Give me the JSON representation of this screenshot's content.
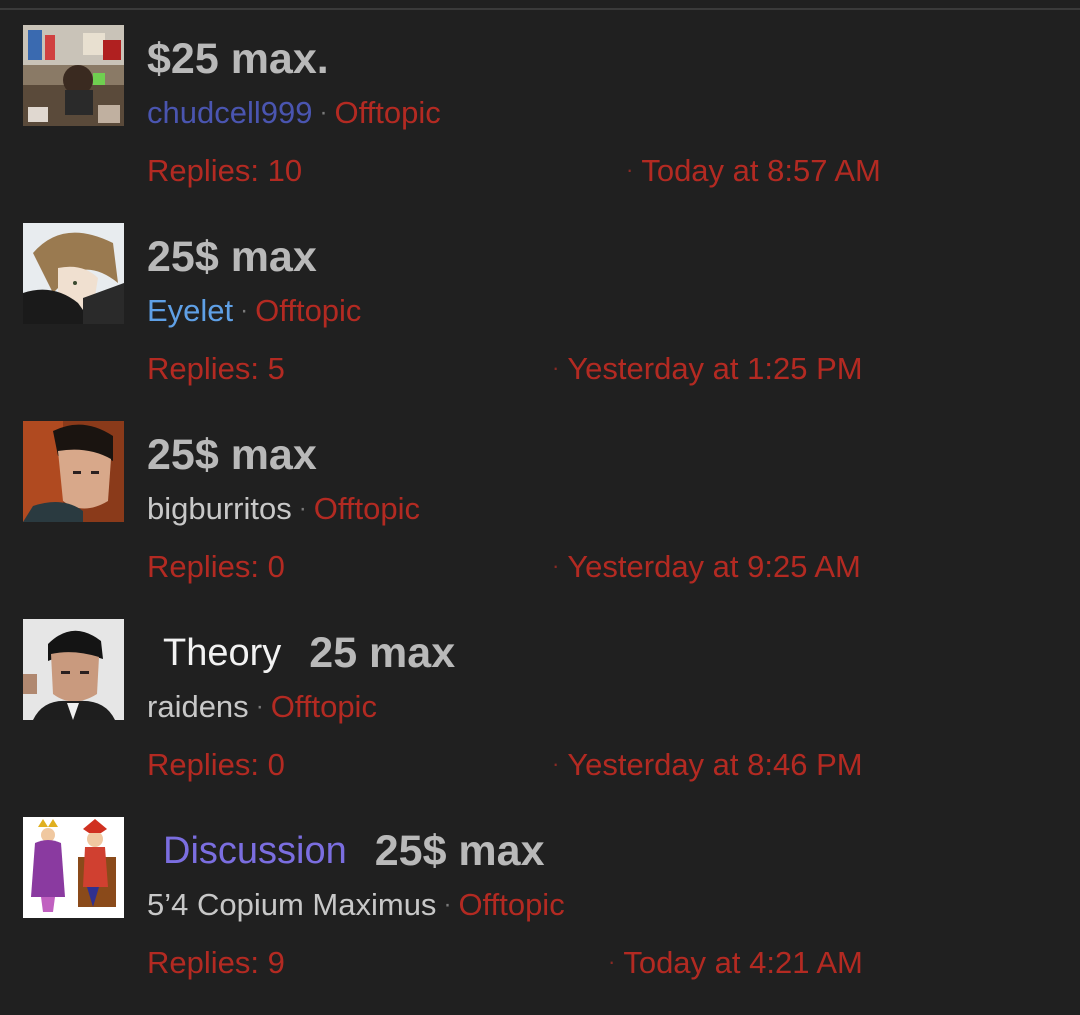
{
  "threads": [
    {
      "title": "$25 max.",
      "prefix": "",
      "author": "chudcell999",
      "author_color": "#4a55b0",
      "forum": "Offtopic",
      "replies": "Replies: 10",
      "date": "Today at 8:57 AM",
      "avatar_icon": "cluttered-room-avatar"
    },
    {
      "title": "25$ max",
      "prefix": "",
      "author": "Eyelet",
      "author_color": "#5fa0e6",
      "forum": "Offtopic",
      "replies": "Replies: 5",
      "date": "Yesterday at 1:25 PM",
      "avatar_icon": "anime-character-avatar"
    },
    {
      "title": "25$ max",
      "prefix": "",
      "author": "bigburritos",
      "author_color": "#c8c8c8",
      "forum": "Offtopic",
      "replies": "Replies: 0",
      "date": "Yesterday at 9:25 AM",
      "avatar_icon": "man-portrait-avatar"
    },
    {
      "title": "25 max",
      "prefix": "Theory",
      "author": "raidens",
      "author_color": "#c8c8c8",
      "forum": "Offtopic",
      "replies": "Replies: 0",
      "date": "Yesterday at 8:46 PM",
      "avatar_icon": "man-headshot-avatar"
    },
    {
      "title": "25$ max",
      "prefix": "Discussion",
      "author": "5’4 Copium Maximus",
      "author_color": "#c8c8c8",
      "forum": "Offtopic",
      "replies": "Replies: 9",
      "date": "Today at 4:21 AM",
      "avatar_icon": "queen-and-jester-avatar"
    }
  ],
  "colors": {
    "background": "#202020",
    "title": "#b9b9b9",
    "forum": "#b32a22",
    "theory_prefix": "#f2f2f2",
    "discussion_prefix": "#7b6ee0"
  }
}
